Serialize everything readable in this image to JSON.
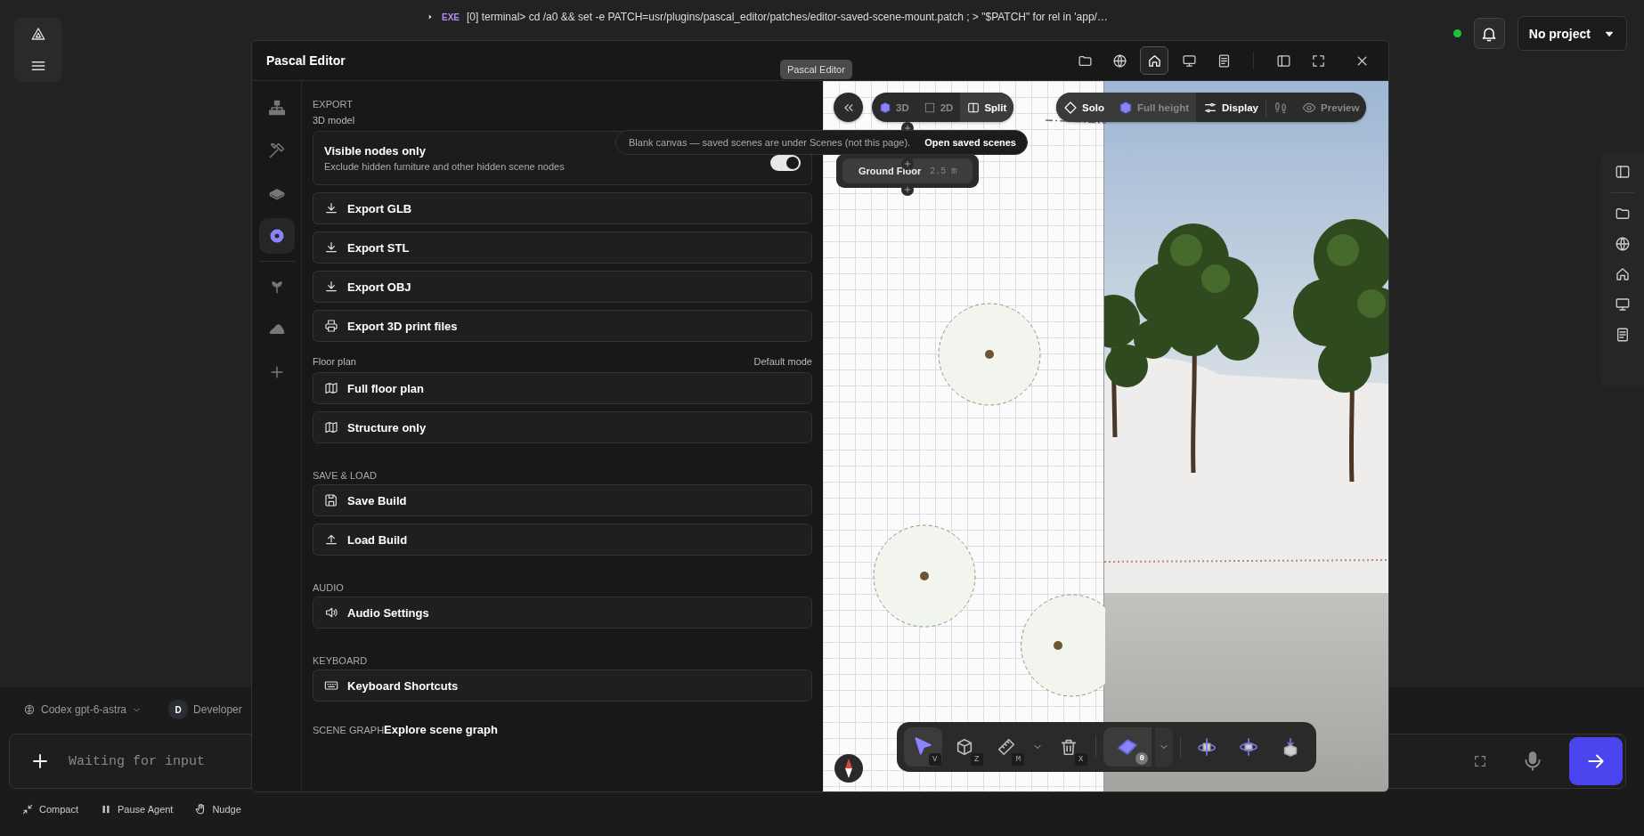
{
  "app": {
    "log_lines": [
      {
        "tag": "EXE",
        "text": "[0] terminal> cd /a0 && set -e PATCH=usr/plugins/pascal_editor/patches/editor-saved-scene-mount.patch ; > \"$PATCH\" for rel in 'app/…"
      }
    ],
    "project": "No project",
    "model": "Codex gpt-6-astra",
    "agent": {
      "initial": "D",
      "name": "Developer"
    },
    "input": {
      "placeholder": "Waiting for input"
    },
    "actions": [
      {
        "kind": "compact",
        "label": "Compact"
      },
      {
        "kind": "pause",
        "label": "Pause Agent"
      },
      {
        "kind": "nudge",
        "label": "Nudge"
      }
    ]
  },
  "editor": {
    "title": "Pascal Editor",
    "tooltip": "Pascal Editor",
    "header_tools": [
      {
        "kind": "folder",
        "selected": false
      },
      {
        "kind": "globe",
        "selected": false
      },
      {
        "kind": "home",
        "selected": true
      },
      {
        "kind": "monitor",
        "selected": false
      },
      {
        "kind": "doc",
        "selected": false
      }
    ],
    "rail": [
      {
        "kind": "hier",
        "selected": false
      },
      {
        "kind": "tools",
        "selected": false
      },
      {
        "kind": "sofa",
        "selected": false
      },
      {
        "kind": "gear",
        "selected": true
      },
      {
        "kind": "sprout",
        "selected": false
      },
      {
        "kind": "terrain",
        "selected": false
      },
      {
        "kind": "plus",
        "selected": false
      }
    ],
    "panel": [
      {
        "kind": "heading",
        "text": "EXPORT"
      },
      {
        "kind": "subheading",
        "text": "3D model"
      },
      {
        "kind": "toggle",
        "title": "Visible nodes only",
        "description": "Exclude hidden furniture and other hidden scene nodes",
        "on": true
      },
      {
        "kind": "download",
        "label": "Export GLB"
      },
      {
        "kind": "download",
        "label": "Export STL"
      },
      {
        "kind": "download",
        "label": "Export OBJ"
      },
      {
        "kind": "printer",
        "label": "Export 3D print files"
      },
      {
        "kind": "subheading",
        "text": "Floor plan",
        "aside": "Default mode"
      },
      {
        "kind": "map",
        "label": "Full floor plan"
      },
      {
        "kind": "map",
        "label": "Structure only"
      },
      {
        "kind": "heading",
        "text": "SAVE & LOAD"
      },
      {
        "kind": "save",
        "label": "Save Build"
      },
      {
        "kind": "upload",
        "label": "Load Build"
      },
      {
        "kind": "heading",
        "text": "AUDIO"
      },
      {
        "kind": "speaker",
        "label": "Audio Settings"
      },
      {
        "kind": "heading",
        "text": "KEYBOARD"
      },
      {
        "kind": "keyboard",
        "label": "Keyboard Shortcuts"
      },
      {
        "kind": "inline",
        "heading": "SCENE GRAPH",
        "link": "Explore scene graph"
      }
    ],
    "notice": {
      "text": "Blank canvas — saved scenes are under Scenes (not this page).",
      "action": "Open saved scenes"
    },
    "viewport": {
      "modes": [
        {
          "kind": "cube",
          "label": "3D",
          "selected": false
        },
        {
          "kind": "grid2d",
          "label": "2D",
          "selected": false
        },
        {
          "kind": "split",
          "label": "Split",
          "selected": true
        }
      ],
      "options": [
        {
          "kind": "diamond",
          "label": "Solo",
          "dimmed": false,
          "highlighted": true
        },
        {
          "kind": "cube",
          "label": "Full height",
          "dimmed": true,
          "highlighted": true
        },
        {
          "kind": "sliders",
          "label": "Display",
          "dimmed": false,
          "highlighted": false
        },
        {
          "kind": "feet",
          "dimmed": true,
          "highlighted": false
        },
        {
          "kind": "eye",
          "label": "Preview",
          "dimmed": true,
          "highlighted": false
        }
      ],
      "level": {
        "name": "Ground Floor",
        "height": "2.5 m"
      },
      "tools": [
        {
          "kind": "pointer",
          "key": "V",
          "selected": true,
          "menu": false
        },
        {
          "kind": "wirebox",
          "key": "Z",
          "selected": false,
          "menu": false
        },
        {
          "kind": "ruler",
          "key": "M",
          "selected": false,
          "menu": true
        },
        {
          "kind": "trash",
          "key": "X",
          "selected": false,
          "menu": false
        },
        {
          "kind": "floor",
          "badge": "0",
          "selected": true,
          "menu": true
        },
        {
          "kind": "rotate",
          "selected": false,
          "menu": false
        },
        {
          "kind": "orbit",
          "selected": false,
          "menu": false
        },
        {
          "kind": "drop",
          "selected": false,
          "menu": false
        }
      ]
    }
  }
}
